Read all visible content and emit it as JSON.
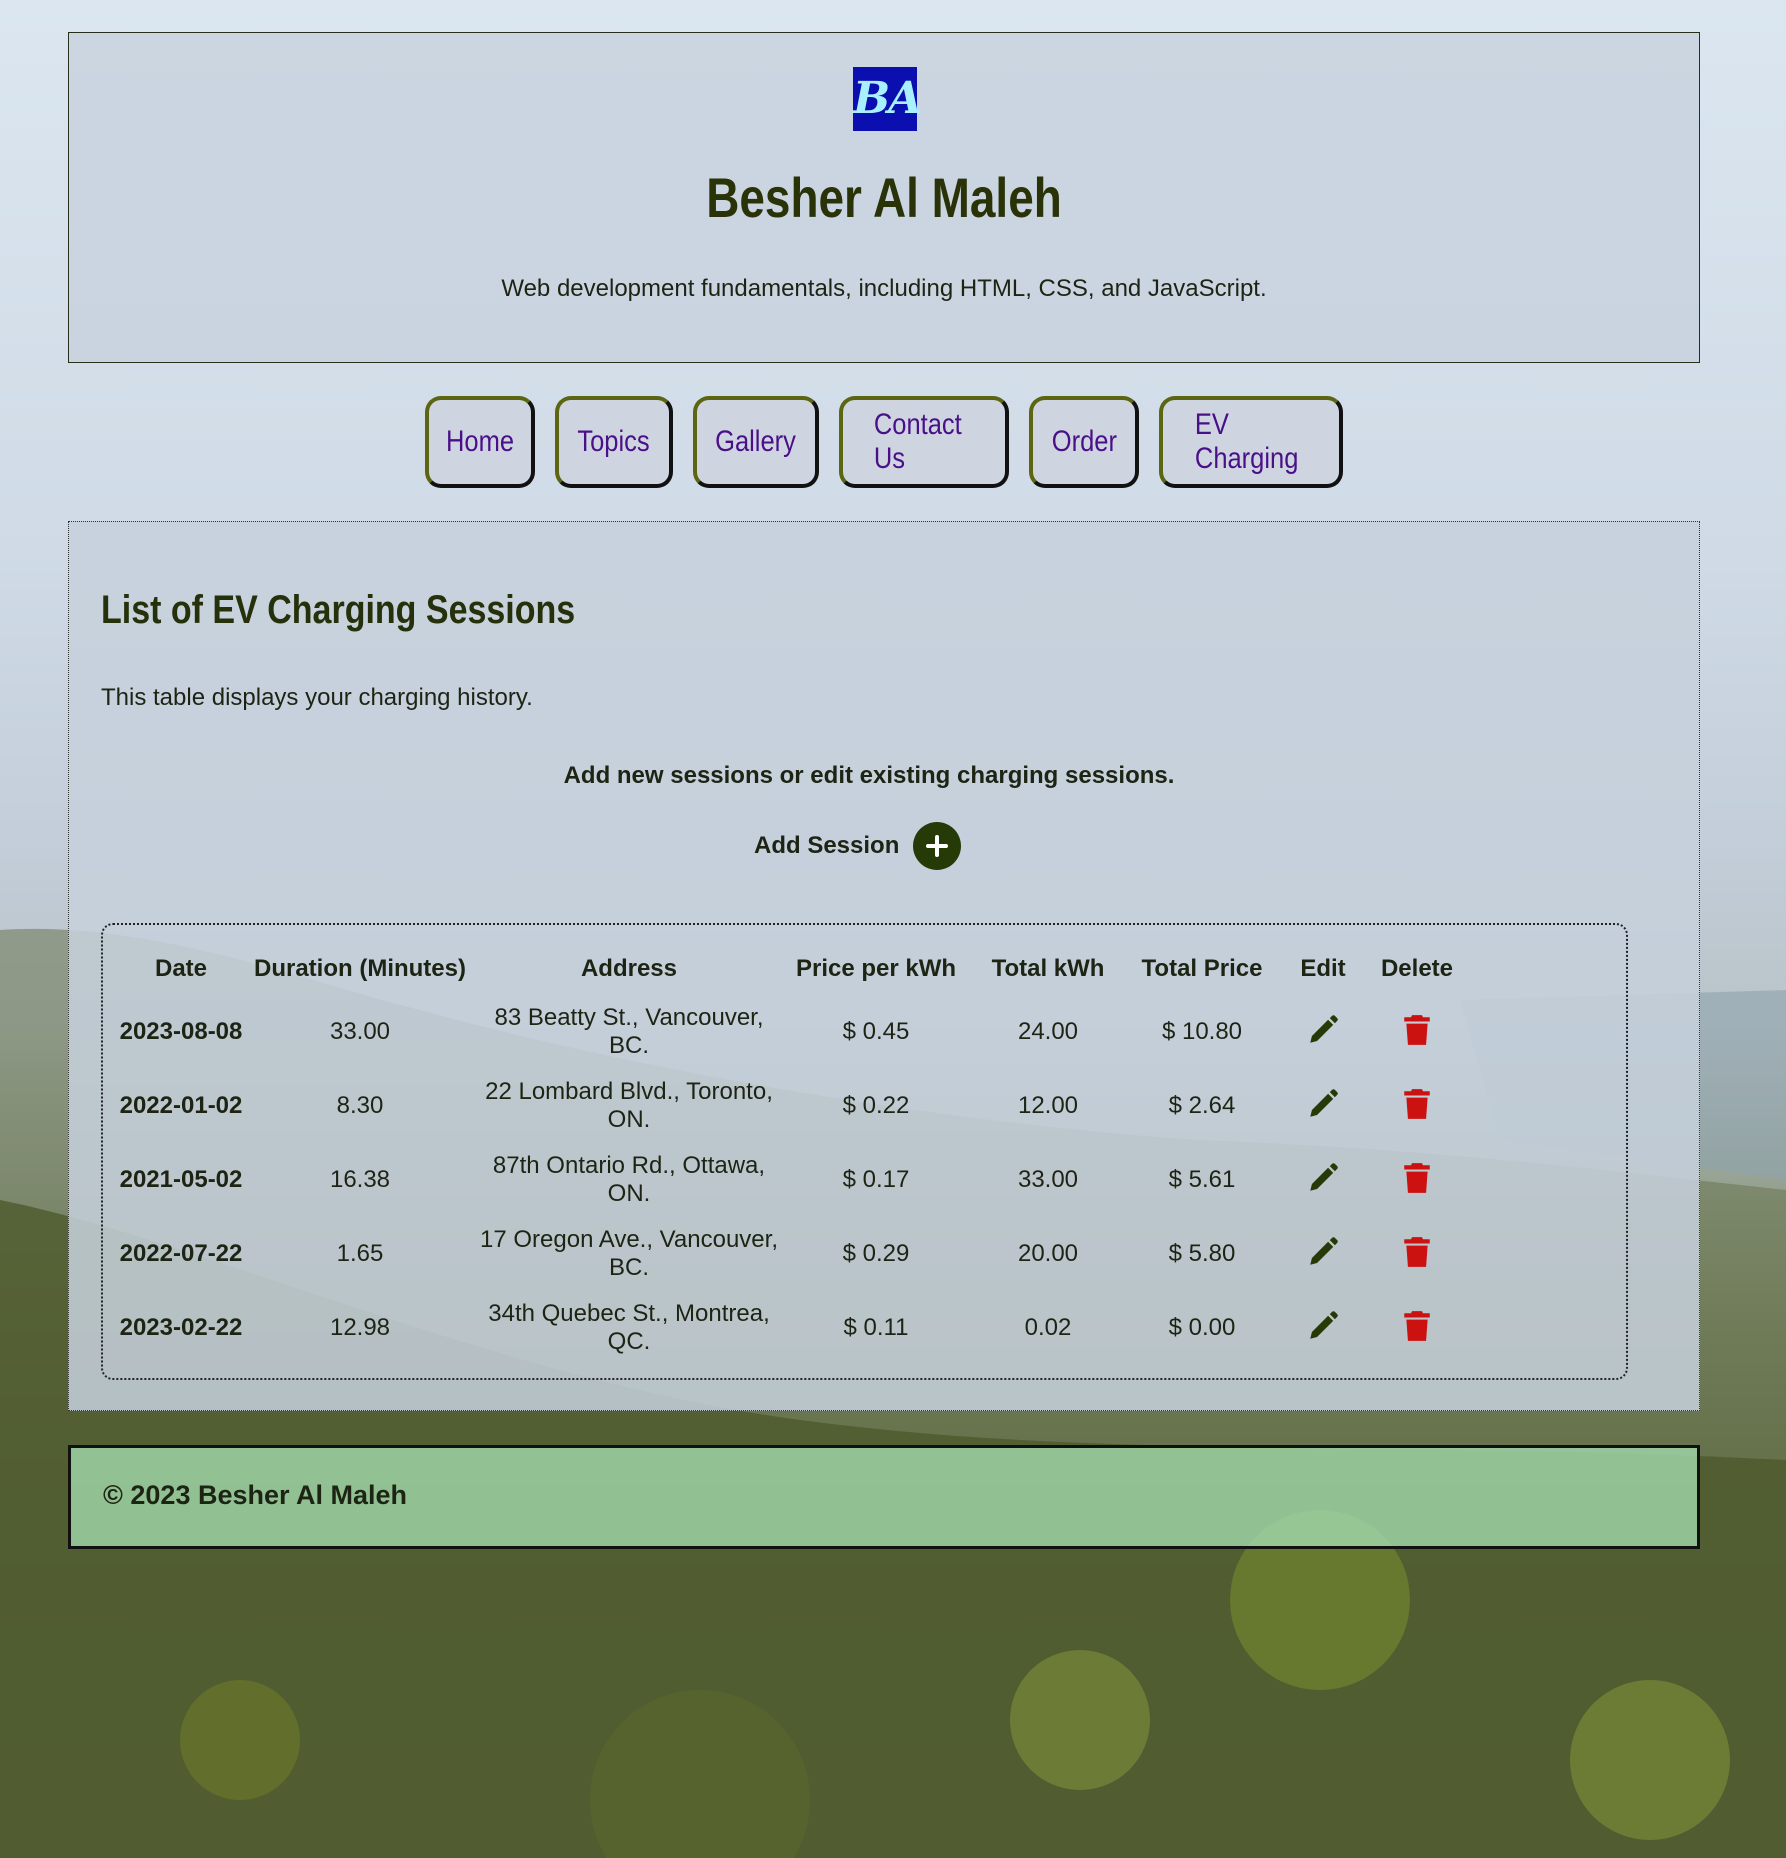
{
  "header": {
    "logo_text": "BA",
    "title": "Besher Al Maleh",
    "tagline": "Web development fundamentals, including HTML, CSS, and JavaScript."
  },
  "nav": {
    "items": [
      {
        "label": "Home"
      },
      {
        "label": "Topics"
      },
      {
        "label": "Gallery"
      },
      {
        "label": "Contact Us"
      },
      {
        "label": "Order"
      },
      {
        "label": "EV Charging"
      }
    ]
  },
  "content": {
    "title": "List of EV Charging Sessions",
    "description": "This table displays your charging history.",
    "note": "Add new sessions or edit existing charging sessions.",
    "add_label": "Add Session",
    "table": {
      "headers": [
        "Date",
        "Duration (Minutes)",
        "Address",
        "Price per kWh",
        "Total kWh",
        "Total Price",
        "Edit",
        "Delete"
      ],
      "rows": [
        {
          "date": "2023-08-08",
          "duration": "33.00",
          "address": "83 Beatty St., Vancouver, BC.",
          "price_per_kwh": "$ 0.45",
          "total_kwh": "24.00",
          "total_price": "$ 10.80"
        },
        {
          "date": "2022-01-02",
          "duration": "8.30",
          "address": "22 Lombard Blvd., Toronto, ON.",
          "price_per_kwh": "$ 0.22",
          "total_kwh": "12.00",
          "total_price": "$ 2.64"
        },
        {
          "date": "2021-05-02",
          "duration": "16.38",
          "address": "87th Ontario Rd., Ottawa, ON.",
          "price_per_kwh": "$ 0.17",
          "total_kwh": "33.00",
          "total_price": "$ 5.61"
        },
        {
          "date": "2022-07-22",
          "duration": "1.65",
          "address": "17 Oregon Ave., Vancouver, BC.",
          "price_per_kwh": "$ 0.29",
          "total_kwh": "20.00",
          "total_price": "$ 5.80"
        },
        {
          "date": "2023-02-22",
          "duration": "12.98",
          "address": "34th Quebec St., Montrea, QC.",
          "price_per_kwh": "$ 0.11",
          "total_kwh": "0.02",
          "total_price": "$ 0.00"
        }
      ]
    }
  },
  "footer": {
    "text": "© 2023 Besher Al Maleh"
  },
  "colors": {
    "nav_text": "#4a1088",
    "delete_icon": "#cc1111",
    "edit_icon": "#263a08",
    "footer_bg": "#a0d7aa"
  },
  "icons": {
    "add": "plus-circle-icon",
    "edit": "pencil-icon",
    "delete": "trash-icon"
  }
}
